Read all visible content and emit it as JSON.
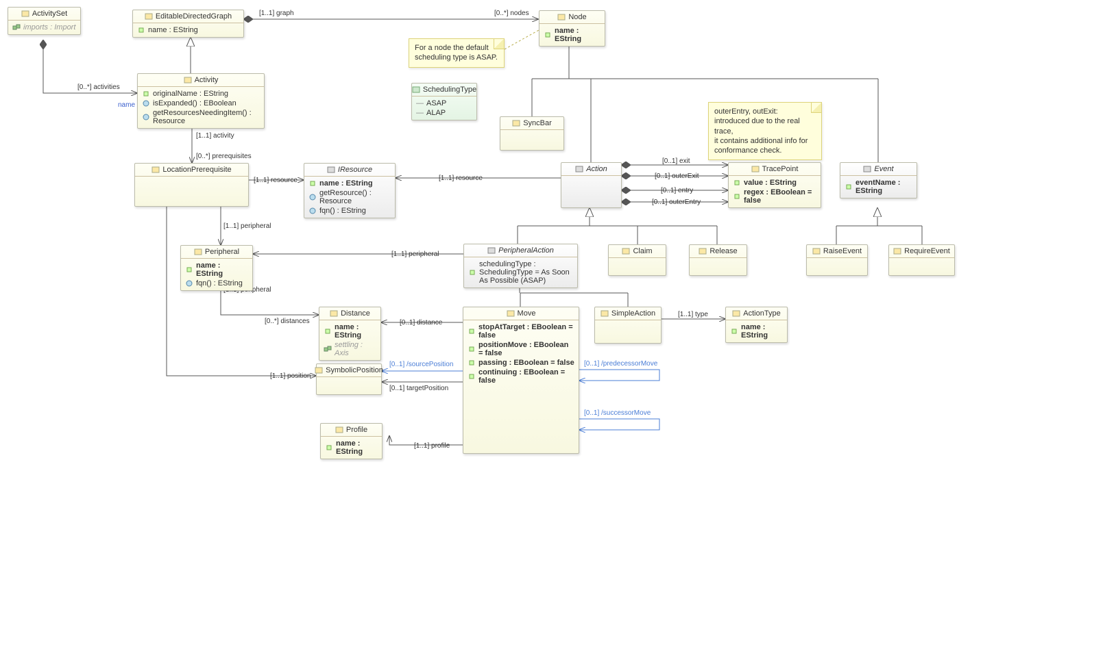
{
  "notes": {
    "nodeNote": "For a node the default scheduling type is ASAP.",
    "traceNote": "outerEntry, outExit:\nintroduced due to the real trace,\nit contains additional info for\nconformance check."
  },
  "classes": {
    "ActivitySet": {
      "name": "ActivitySet",
      "attrs": {
        "imports": "imports : Import"
      }
    },
    "EditableDirectedGraph": {
      "name": "EditableDirectedGraph",
      "attrs": {
        "name": "name : EString"
      }
    },
    "Node": {
      "name": "Node",
      "attrs": {
        "name": "name : EString"
      }
    },
    "Activity": {
      "name": "Activity",
      "attrs": {
        "originalName": "originalName : EString",
        "isExpanded": "isExpanded() : EBoolean",
        "getRes": "getResourcesNeedingItem() : Resource"
      }
    },
    "SchedulingType": {
      "name": "SchedulingType",
      "lits": {
        "asap": "ASAP",
        "alap": "ALAP"
      }
    },
    "SyncBar": {
      "name": "SyncBar"
    },
    "LocationPrerequisite": {
      "name": "LocationPrerequisite"
    },
    "IResource": {
      "name": "IResource",
      "attrs": {
        "name": "name : EString",
        "getResource": "getResource() : Resource",
        "fqn": "fqn() : EString"
      }
    },
    "Action": {
      "name": "Action"
    },
    "TracePoint": {
      "name": "TracePoint",
      "attrs": {
        "value": "value : EString",
        "regex": "regex : EBoolean = false"
      }
    },
    "Event": {
      "name": "Event",
      "attrs": {
        "eventName": "eventName : EString"
      }
    },
    "Peripheral": {
      "name": "Peripheral",
      "attrs": {
        "name": "name : EString",
        "fqn": "fqn() : EString"
      }
    },
    "PeripheralAction": {
      "name": "PeripheralAction",
      "attrs": {
        "sched": "schedulingType : SchedulingType = As Soon As Possible (ASAP)"
      }
    },
    "Claim": {
      "name": "Claim"
    },
    "Release": {
      "name": "Release"
    },
    "RaiseEvent": {
      "name": "RaiseEvent"
    },
    "RequireEvent": {
      "name": "RequireEvent"
    },
    "Distance": {
      "name": "Distance",
      "attrs": {
        "name": "name : EString",
        "settling": "settling : Axis"
      }
    },
    "Move": {
      "name": "Move",
      "attrs": {
        "stopAtTarget": "stopAtTarget : EBoolean = false",
        "positionMove": "positionMove : EBoolean = false",
        "passing": "passing : EBoolean = false",
        "continuing": "continuing : EBoolean = false"
      }
    },
    "SimpleAction": {
      "name": "SimpleAction"
    },
    "ActionType": {
      "name": "ActionType",
      "attrs": {
        "name": "name : EString"
      }
    },
    "SymbolicPosition": {
      "name": "SymbolicPosition"
    },
    "Profile": {
      "name": "Profile",
      "attrs": {
        "name": "name : EString"
      }
    }
  },
  "labels": {
    "graph": "[1..1] graph",
    "nodes": "[0..*] nodes",
    "activities": "[0..*] activities",
    "nameRole": "name",
    "activity": "[1..1] activity",
    "prereqs": "[0..*] prerequisites",
    "resource1": "[1..1] resource",
    "resource2": "[1..1] resource",
    "peripheral1": "[1..1] peripheral",
    "peripheral2": "[1..1] peripheral",
    "peripheral3": "[1..1] peripheral",
    "exit": "[0..1] exit",
    "outerExit": "[0..1] outerExit",
    "entry": "[0..1] entry",
    "outerEntry": "[0..1] outerEntry",
    "distances": "[0..*] distances",
    "distance": "[0..1] distance",
    "sourcePosition": "[0..1] /sourcePosition",
    "targetPosition": "[0..1] targetPosition",
    "position": "[1..1] position",
    "profile": "[1..1] profile",
    "type": "[1..1] type",
    "predecessorMove": "[0..1] /predecessorMove",
    "successorMove": "[0..1] /successorMove"
  }
}
